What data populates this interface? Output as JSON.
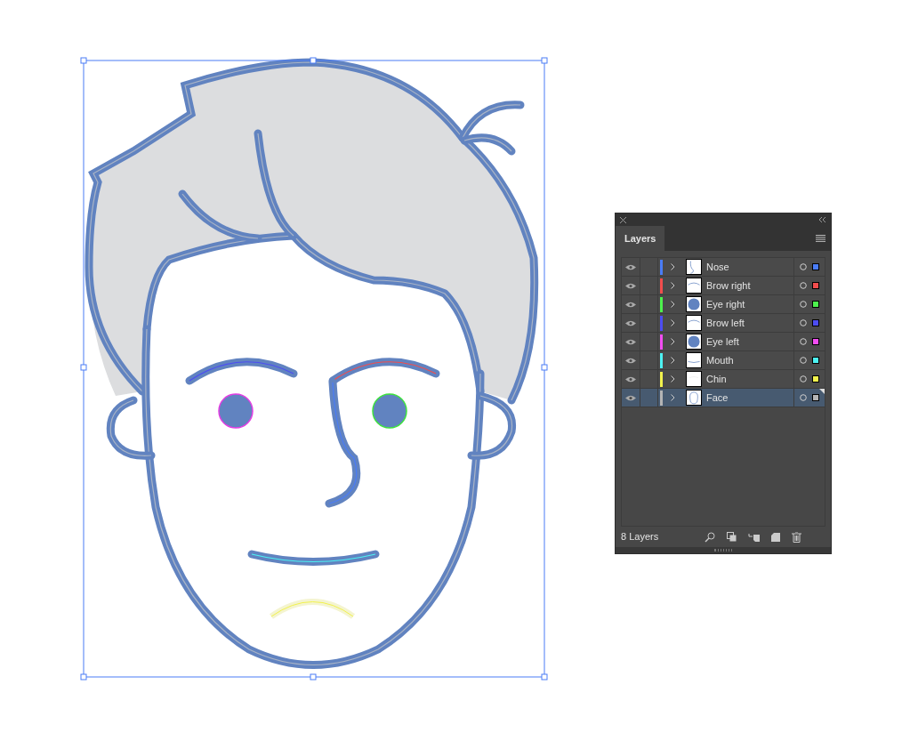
{
  "panel": {
    "tab": "Layers",
    "layers": [
      {
        "name": "Nose",
        "color": "#4a7cf6",
        "kind": "curve",
        "selected": false
      },
      {
        "name": "Brow right",
        "color": "#f24d4d",
        "kind": "arc",
        "selected": false
      },
      {
        "name": "Eye right",
        "color": "#4df24d",
        "kind": "disc",
        "selected": false
      },
      {
        "name": "Brow left",
        "color": "#4d4df2",
        "kind": "arc",
        "selected": false
      },
      {
        "name": "Eye left",
        "color": "#f24df2",
        "kind": "disc",
        "selected": false
      },
      {
        "name": "Mouth",
        "color": "#4df2f2",
        "kind": "line",
        "selected": false
      },
      {
        "name": "Chin",
        "color": "#f2f24d",
        "kind": "blank",
        "selected": false
      },
      {
        "name": "Face",
        "color": "#b4b4b4",
        "kind": "head",
        "selected": true
      }
    ],
    "count": "8 Layers"
  }
}
